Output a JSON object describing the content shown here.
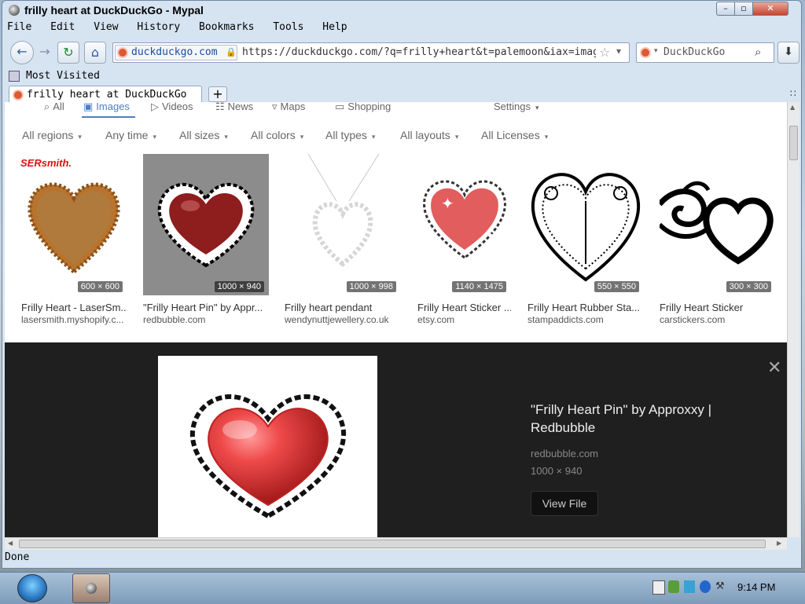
{
  "window": {
    "title": "frilly heart at DuckDuckGo - Mypal"
  },
  "menu": [
    "File",
    "Edit",
    "View",
    "History",
    "Bookmarks",
    "Tools",
    "Help"
  ],
  "nav": {
    "site_label": "duckduckgo.com",
    "url": "https://duckduckgo.com/?q=frilly+heart&t=palemoon&iax=images&ia=images",
    "search_engine_placeholder": "DuckDuckGo"
  },
  "bookmarks": {
    "label": "Most Visited"
  },
  "tab": {
    "title": "frilly heart at DuckDuckGo"
  },
  "serp_tabs": [
    "All",
    "Images",
    "Videos",
    "News",
    "Maps",
    "Shopping",
    "Settings"
  ],
  "filters": [
    "All regions",
    "Any time",
    "All sizes",
    "All colors",
    "All types",
    "All layouts",
    "All Licenses"
  ],
  "results": [
    {
      "caption": "Frilly Heart - LaserSm...",
      "source": "lasersmith.myshopify.c...",
      "dims": "600 × 600",
      "logo_text": "SERsmith."
    },
    {
      "caption": "\"Frilly Heart Pin\" by Appr...",
      "source": "redbubble.com",
      "dims": "1000 × 940"
    },
    {
      "caption": "Frilly heart pendant",
      "source": "wendynuttjewellery.co.uk",
      "dims": "1000 × 998"
    },
    {
      "caption": "Frilly Heart Sticker ...",
      "source": "etsy.com",
      "dims": "1140 × 1475"
    },
    {
      "caption": "Frilly Heart Rubber Sta...",
      "source": "stampaddicts.com",
      "dims": "550 × 550"
    },
    {
      "caption": "Frilly Heart Sticker",
      "source": "carstickers.com",
      "dims": "300 × 300"
    }
  ],
  "detail": {
    "title": "\"Frilly Heart Pin\" by Approxxy | Redbubble",
    "domain": "redbubble.com",
    "dims": "1000 × 940",
    "button": "View File"
  },
  "status": {
    "text": "Done"
  },
  "taskbar": {
    "clock": "9:14 PM"
  },
  "colors": {
    "accent": "#4e7ec2",
    "ddg": "#de5833",
    "heart_red": "#d83a3a"
  }
}
